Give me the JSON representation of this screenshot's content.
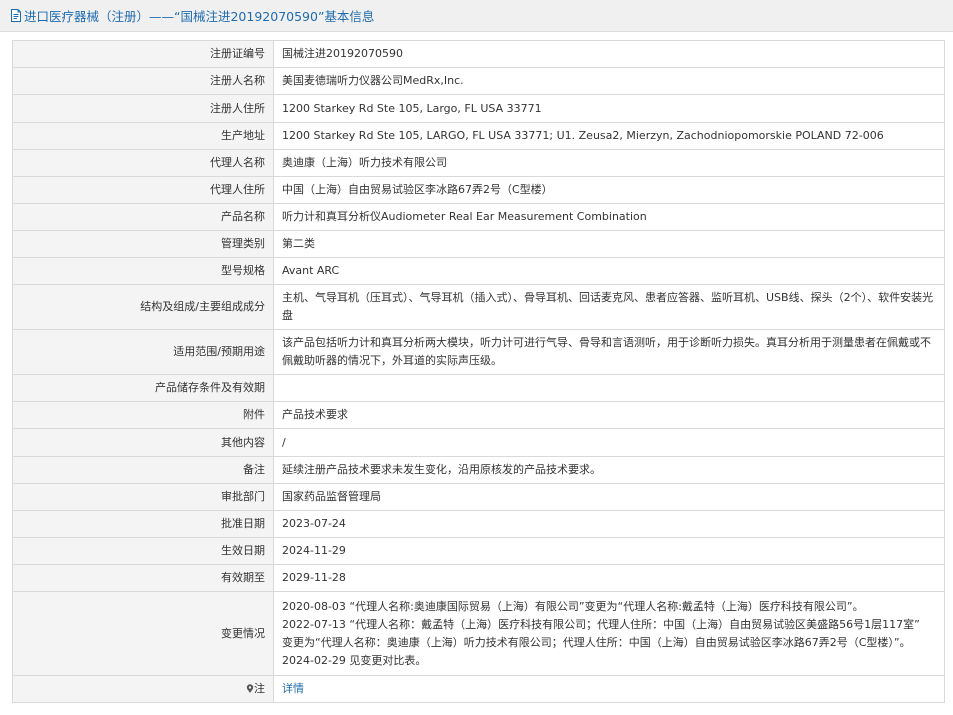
{
  "header": {
    "title": "进口医疗器械（注册）——“国械注进20192070590”基本信息",
    "icon": "document-icon"
  },
  "rows": [
    {
      "label": "注册证编号",
      "value": "国械注进20192070590"
    },
    {
      "label": "注册人名称",
      "value": "美国麦德瑞听力仪器公司MedRx,Inc."
    },
    {
      "label": "注册人住所",
      "value": "1200 Starkey Rd Ste 105, Largo, FL USA 33771"
    },
    {
      "label": "生产地址",
      "value": "1200 Starkey Rd Ste 105, LARGO, FL USA 33771; U1. Zeusa2, Mierzyn, Zachodniopomorskie POLAND 72-006"
    },
    {
      "label": "代理人名称",
      "value": "奥迪康（上海）听力技术有限公司"
    },
    {
      "label": "代理人住所",
      "value": "中国（上海）自由贸易试验区李冰路67弄2号（C型楼）"
    },
    {
      "label": "产品名称",
      "value": "听力计和真耳分析仪Audiometer Real Ear Measurement Combination"
    },
    {
      "label": "管理类别",
      "value": "第二类"
    },
    {
      "label": "型号规格",
      "value": "Avant ARC"
    },
    {
      "label": "结构及组成/主要组成成分",
      "value": "主机、气导耳机（压耳式）、气导耳机（插入式）、骨导耳机、回话麦克风、患者应答器、监听耳机、USB线、探头（2个）、软件安装光盘"
    },
    {
      "label": "适用范围/预期用途",
      "value": "该产品包括听力计和真耳分析两大模块，听力计可进行气导、骨导和言语测听，用于诊断听力损失。真耳分析用于测量患者在佩戴或不佩戴助听器的情况下，外耳道的实际声压级。"
    },
    {
      "label": "产品储存条件及有效期",
      "value": ""
    },
    {
      "label": "附件",
      "value": "产品技术要求"
    },
    {
      "label": "其他内容",
      "value": "/"
    },
    {
      "label": "备注",
      "value": "延续注册产品技术要求未发生变化，沿用原核发的产品技术要求。"
    },
    {
      "label": "审批部门",
      "value": "国家药品监督管理局"
    },
    {
      "label": "批准日期",
      "value": "2023-07-24"
    },
    {
      "label": "生效日期",
      "value": "2024-11-29"
    },
    {
      "label": "有效期至",
      "value": "2029-11-28"
    }
  ],
  "changes": {
    "label": "变更情况",
    "lines": [
      "2020-08-03 “代理人名称:奥迪康国际贸易（上海）有限公司”变更为“代理人名称:戴孟特（上海）医疗科技有限公司”。",
      "2022-07-13 “代理人名称：戴孟特（上海）医疗科技有限公司；代理人住所：中国（上海）自由贸易试验区美盛路56号1层117室”",
      "变更为“代理人名称：奥迪康（上海）听力技术有限公司；代理人住所：中国（上海）自由贸易试验区李冰路67弄2号（C型楼）”。",
      "2024-02-29 见变更对比表。"
    ]
  },
  "note": {
    "label": "注",
    "icon": "pin-icon",
    "link_text": "详情",
    "link_color": "#1e6bb0"
  }
}
